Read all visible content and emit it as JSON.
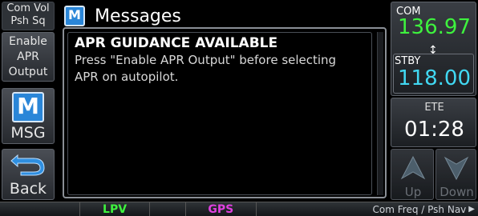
{
  "left_keys": {
    "com_vol_label": "Com Vol",
    "psh_sq_label": "Psh Sq",
    "enable_apr_line1": "Enable",
    "enable_apr_line2": "APR",
    "enable_apr_line3": "Output",
    "msg_icon": "M",
    "msg_label": "MSG",
    "back_label": "Back"
  },
  "messages": {
    "title_icon": "M",
    "title": "Messages",
    "items": [
      {
        "heading": "APR GUIDANCE AVAILABLE",
        "line1": "Press \"Enable APR Output\" before selecting",
        "line2": "APR on autopilot."
      }
    ]
  },
  "radio": {
    "com_label": "COM",
    "com_freq": "136.97",
    "swap_icon": "↕",
    "stby_label": "STBY",
    "stby_freq": "118.00",
    "ete_label": "ETE",
    "ete_value": "01:28",
    "up_label": "Up",
    "down_label": "Down"
  },
  "status_bar": {
    "mode1": "LPV",
    "mode2": "GPS",
    "hint": "Com Freq / Psh Nav"
  },
  "colors": {
    "green": "#3ef23e",
    "cyan": "#41d8f2",
    "magenta": "#e040e0",
    "icon_blue": "#2a86d8"
  }
}
